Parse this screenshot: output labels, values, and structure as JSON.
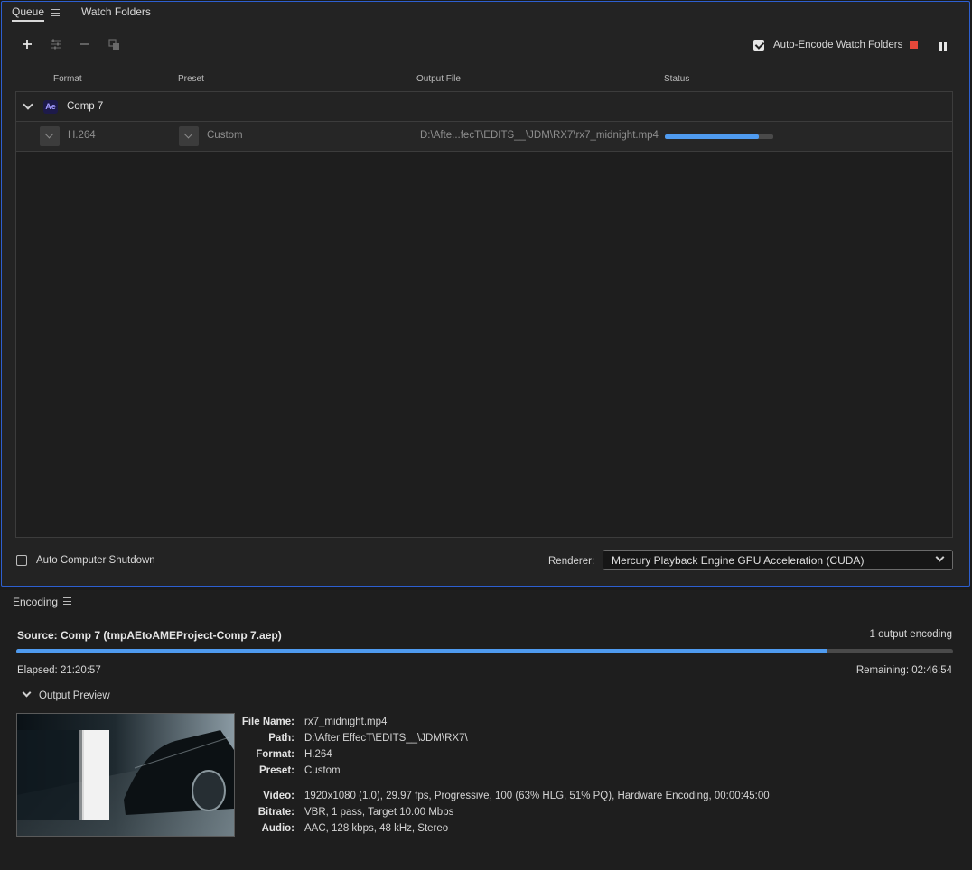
{
  "queue_panel": {
    "tabs": [
      {
        "label": "Queue",
        "active": true
      },
      {
        "label": "Watch Folders",
        "active": false
      }
    ],
    "toolbar": {
      "add_icon": "plus-icon",
      "settings_icon": "sliders-icon",
      "remove_icon": "minus-icon",
      "duplicate_icon": "duplicate-icon"
    },
    "auto_encode": {
      "label": "Auto-Encode Watch Folders",
      "checked": true
    },
    "columns": {
      "format": "Format",
      "preset": "Preset",
      "output": "Output File",
      "status": "Status"
    },
    "group": {
      "badge": "Ae",
      "name": "Comp 7"
    },
    "item": {
      "format": "H.264",
      "preset": "Custom",
      "output_file": "D:\\Afte...fecT\\EDITS__\\JDM\\RX7\\rx7_midnight.mp4",
      "progress": 0.87
    },
    "auto_shutdown": {
      "label": "Auto Computer Shutdown",
      "checked": false
    },
    "renderer": {
      "label": "Renderer:",
      "value": "Mercury Playback Engine GPU Acceleration (CUDA)"
    }
  },
  "encoding_panel": {
    "title": "Encoding",
    "source": "Source: Comp 7 (tmpAEtoAMEProject-Comp 7.aep)",
    "output_count": "1 output encoding",
    "progress": 0.865,
    "elapsed": "Elapsed: 21:20:57",
    "remaining": "Remaining: 02:46:54",
    "output_preview_label": "Output Preview",
    "details": {
      "file_name_label": "File Name:",
      "file_name": "rx7_midnight.mp4",
      "path_label": "Path:",
      "path": "D:\\After EffecT\\EDITS__\\JDM\\RX7\\",
      "format_label": "Format:",
      "format": "H.264",
      "preset_label": "Preset:",
      "preset": "Custom",
      "video_label": "Video:",
      "video": "1920x1080 (1.0), 29.97 fps, Progressive, 100 (63% HLG, 51% PQ), Hardware Encoding, 00:00:45:00",
      "bitrate_label": "Bitrate:",
      "bitrate": "VBR, 1 pass, Target 10.00 Mbps",
      "audio_label": "Audio:",
      "audio": "AAC, 128 kbps, 48 kHz, Stereo"
    }
  },
  "colors": {
    "accent": "#4f9bf0",
    "stop": "#e5483a",
    "panel_focus": "#2d5fd0"
  }
}
